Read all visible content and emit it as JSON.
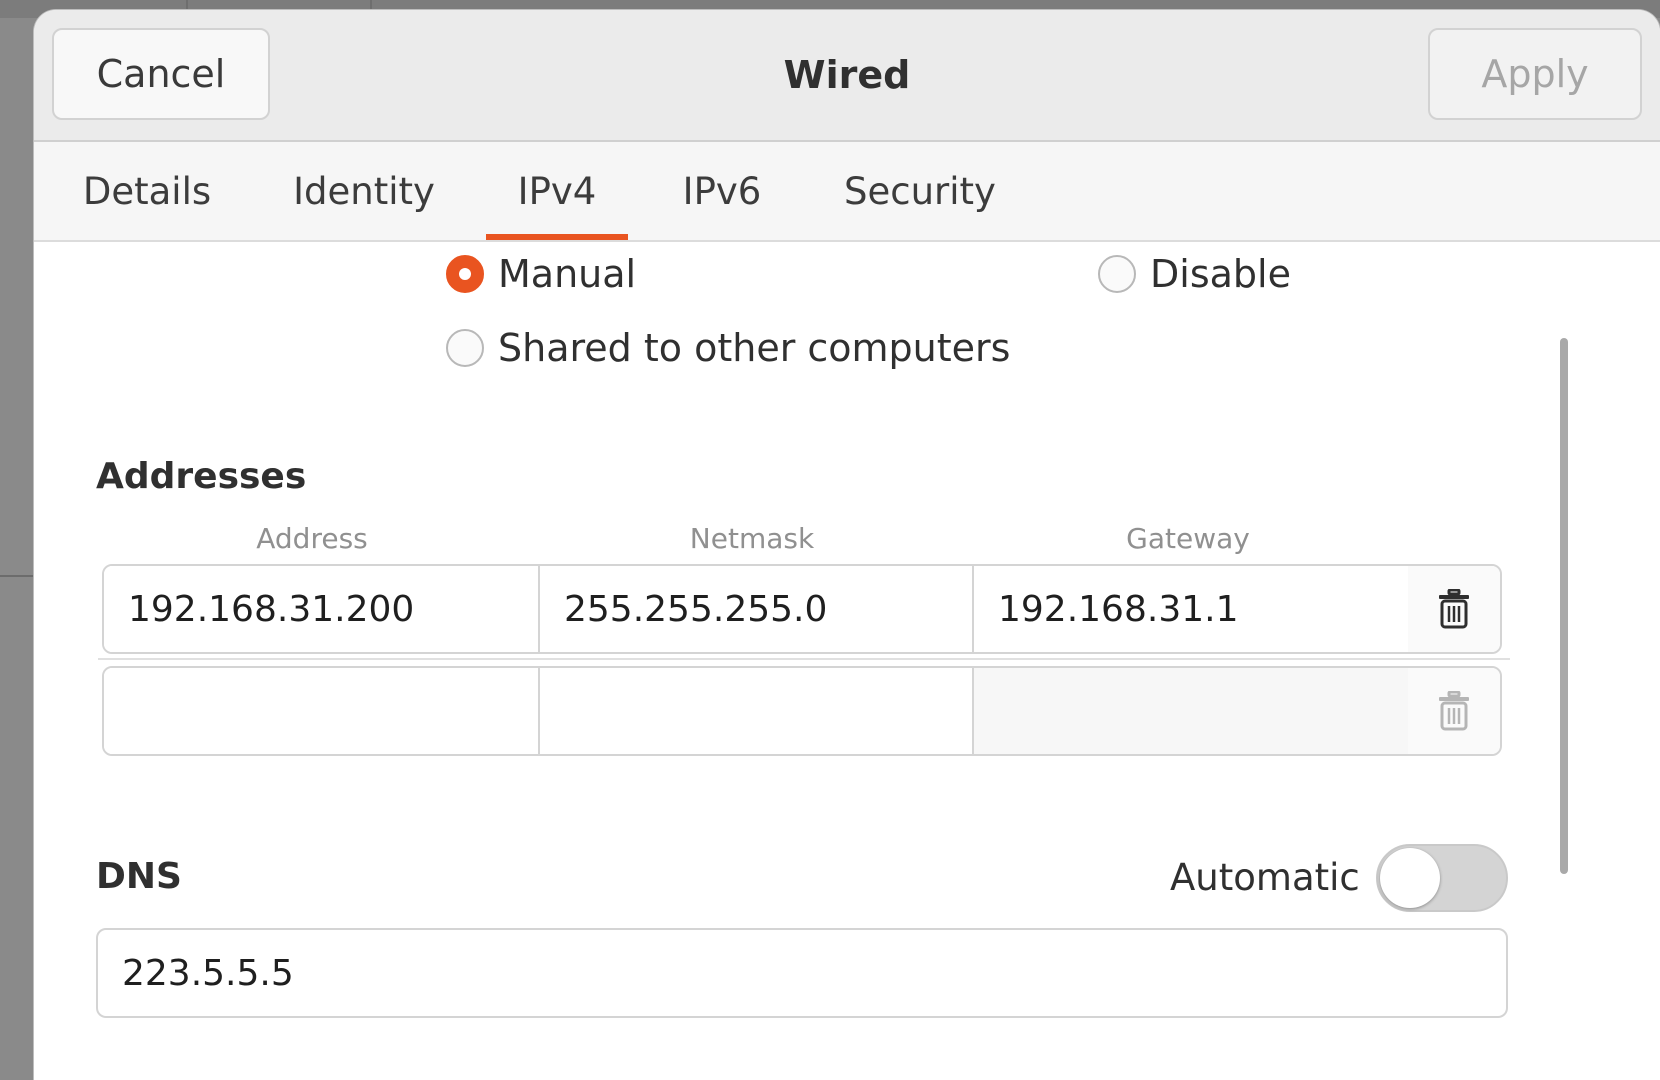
{
  "header": {
    "title": "Wired",
    "cancel_label": "Cancel",
    "apply_label": "Apply"
  },
  "tabs": [
    {
      "label": "Details",
      "active": false
    },
    {
      "label": "Identity",
      "active": false
    },
    {
      "label": "IPv4",
      "active": true
    },
    {
      "label": "IPv6",
      "active": false
    },
    {
      "label": "Security",
      "active": false
    }
  ],
  "ipv4_method": {
    "options": [
      {
        "label": "Manual",
        "selected": true
      },
      {
        "label": "Disable",
        "selected": false
      },
      {
        "label": "Shared to other computers",
        "selected": false
      }
    ]
  },
  "addresses": {
    "title": "Addresses",
    "columns": [
      "Address",
      "Netmask",
      "Gateway"
    ],
    "rows": [
      {
        "address": "192.168.31.200",
        "netmask": "255.255.255.0",
        "gateway": "192.168.31.1"
      },
      {
        "address": "",
        "netmask": "",
        "gateway": ""
      }
    ]
  },
  "dns": {
    "title": "DNS",
    "automatic_label": "Automatic",
    "automatic_on": false,
    "value": "223.5.5.5"
  },
  "icons": {
    "delete": "trash-icon"
  },
  "colors": {
    "accent": "#e95420"
  }
}
